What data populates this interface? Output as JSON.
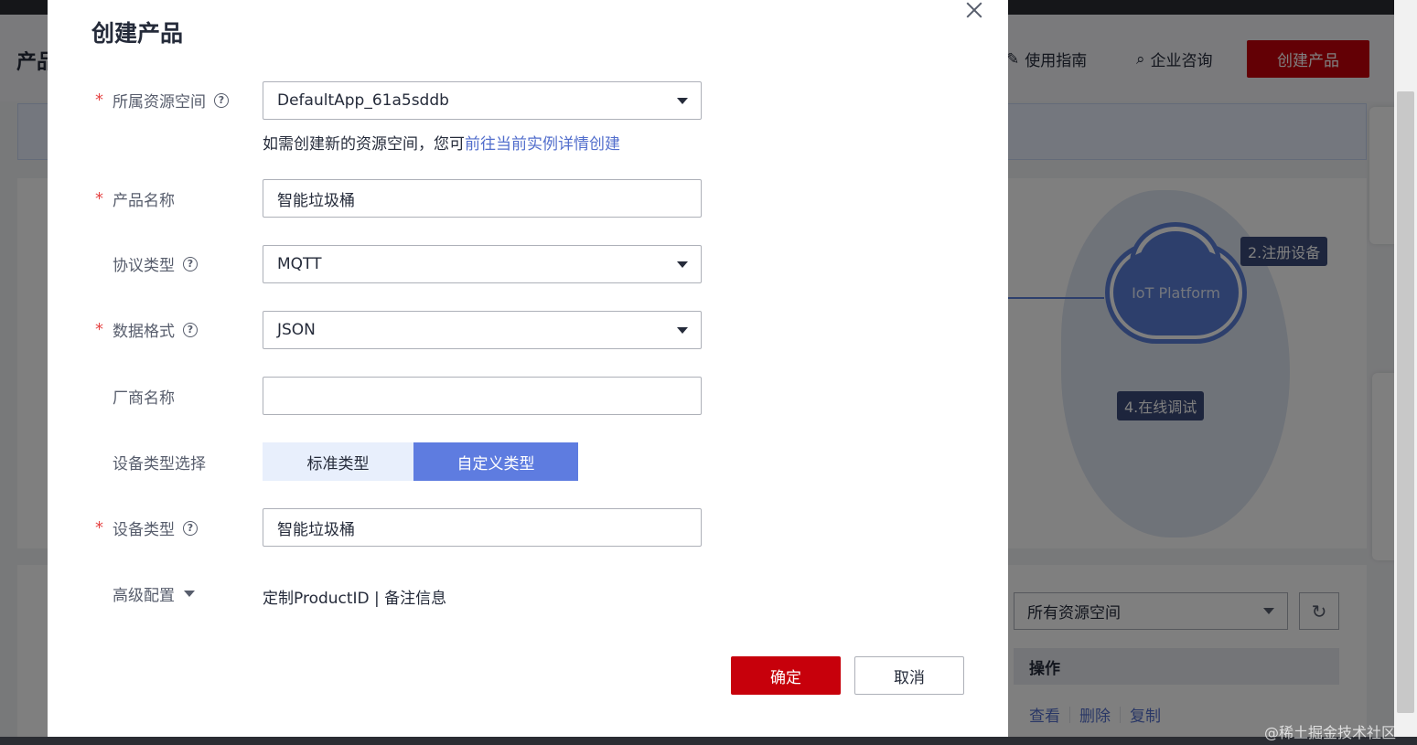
{
  "background": {
    "page_title": "产品",
    "header_links": [
      {
        "label": "使用指南",
        "icon": "guide-icon"
      },
      {
        "label": "企业咨询",
        "icon": "consult-icon"
      }
    ],
    "create_button": "创建产品",
    "diagram": {
      "cloud_label": "IoT Platform",
      "step_register": "2.注册设备",
      "step_debug": "4.在线调试"
    },
    "space_select": "所有资源空间",
    "table_header_action": "操作",
    "row_actions": [
      "查看",
      "删除",
      "复制"
    ],
    "watermark": "@稀土掘金技术社区"
  },
  "modal": {
    "title": "创建产品",
    "fields": {
      "resource_space": {
        "label": "所属资源空间",
        "value": "DefaultApp_61a5sddb",
        "hint_prefix": "如需创建新的资源空间，您可",
        "hint_link": "前往当前实例详情创建"
      },
      "product_name": {
        "label": "产品名称",
        "value": "智能垃圾桶"
      },
      "protocol": {
        "label": "协议类型",
        "value": "MQTT"
      },
      "data_format": {
        "label": "数据格式",
        "value": "JSON"
      },
      "manufacturer": {
        "label": "厂商名称",
        "value": ""
      },
      "device_type_select": {
        "label": "设备类型选择",
        "options": [
          "标准类型",
          "自定义类型"
        ],
        "selected": "自定义类型"
      },
      "device_type": {
        "label": "设备类型",
        "value": "智能垃圾桶"
      },
      "advanced": {
        "label": "高级配置",
        "links": "定制ProductID | 备注信息"
      }
    },
    "buttons": {
      "ok": "确定",
      "cancel": "取消"
    }
  }
}
